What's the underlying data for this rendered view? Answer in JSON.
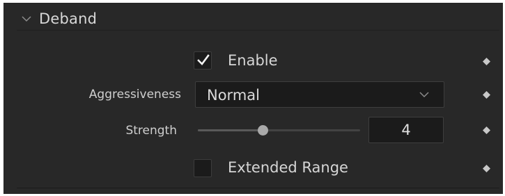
{
  "section": {
    "title": "Deband",
    "expanded": true
  },
  "enable": {
    "label": "Enable",
    "checked": true
  },
  "aggressiveness": {
    "label": "Aggressiveness",
    "selected": "Normal"
  },
  "strength": {
    "label": "Strength",
    "value": "4",
    "slider_fraction": 0.4
  },
  "extended_range": {
    "label": "Extended Range",
    "checked": false
  },
  "icons": {
    "expand": "chevron-down-icon",
    "keyframe": "keyframe-diamond-icon",
    "check": "checkmark-icon",
    "dropdown": "chevron-down-icon"
  },
  "colors": {
    "panel_bg": "#282828",
    "field_bg": "#1b1b1b",
    "text": "#d6d6d6",
    "keyframe": "#c8c8c8"
  }
}
